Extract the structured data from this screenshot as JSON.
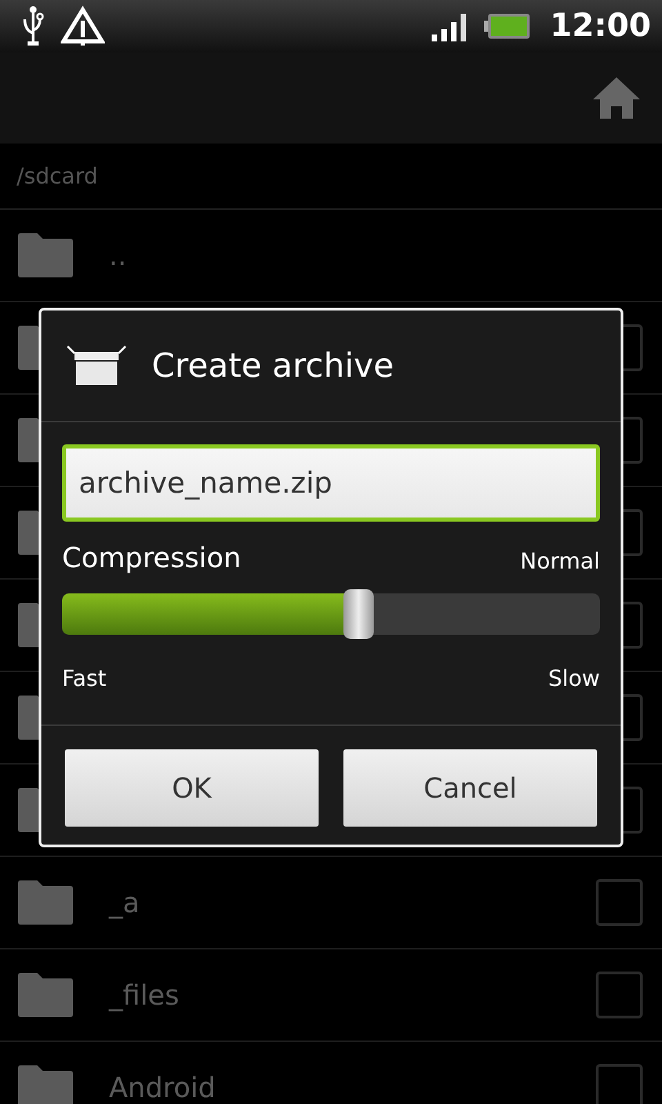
{
  "status_bar": {
    "time": "12:00"
  },
  "path": "/sdcard",
  "files": [
    {
      "kind": "parent",
      "name": ".."
    },
    {
      "kind": "covered"
    },
    {
      "kind": "covered"
    },
    {
      "kind": "covered"
    },
    {
      "kind": "covered"
    },
    {
      "kind": "covered"
    },
    {
      "kind": "covered"
    },
    {
      "kind": "folder",
      "name": "_a",
      "checked": false
    },
    {
      "kind": "folder",
      "name": "_files",
      "checked": false
    },
    {
      "kind": "folder",
      "name": "Android",
      "checked": false
    }
  ],
  "dialog": {
    "title": "Create archive",
    "field": {
      "value": "archive_name.zip"
    },
    "slider": {
      "label": "Compression",
      "reading": "Normal",
      "level": 0.55,
      "min_label": "Fast",
      "max_label": "Slow"
    },
    "buttons": [
      "OK",
      "Cancel"
    ]
  }
}
